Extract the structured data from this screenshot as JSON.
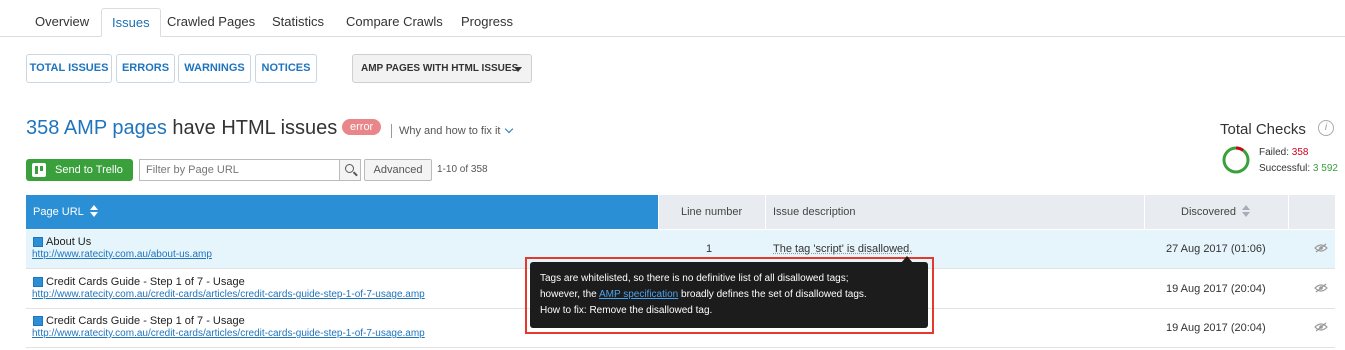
{
  "tabs": [
    "Overview",
    "Issues",
    "Crawled Pages",
    "Statistics",
    "Compare Crawls",
    "Progress"
  ],
  "active_tab": "Issues",
  "filters": [
    "TOTAL ISSUES",
    "ERRORS",
    "WARNINGS",
    "NOTICES"
  ],
  "issue_select": "AMP PAGES WITH HTML ISSUES",
  "heading": {
    "count": "358 AMP pages",
    "rest": " have HTML issues",
    "badge": "error",
    "why": "Why and how to fix it"
  },
  "toolbar": {
    "trello": "Send to Trello",
    "filter_placeholder": "Filter by Page URL",
    "advanced": "Advanced",
    "range": "1-10 of 358"
  },
  "total_checks": {
    "title": "Total Checks",
    "info": "i",
    "failed_label": "Failed:",
    "failed": "358",
    "success_label": "Successful:",
    "success": "3 592",
    "failed_color": "#d0021b",
    "success_color": "#3aa03c"
  },
  "columns": {
    "url": "Page URL",
    "line": "Line number",
    "desc": "Issue description",
    "discovered": "Discovered"
  },
  "rows": [
    {
      "title": "About Us",
      "url": "http://www.ratecity.com.au/about-us.amp",
      "line": "1",
      "desc": "The tag 'script' is disallowed.",
      "date": "27 Aug 2017 (01:06)"
    },
    {
      "title": "Credit Cards Guide - Step 1 of 7 - Usage",
      "url": "http://www.ratecity.com.au/credit-cards/articles/credit-cards-guide-step-1-of-7-usage.amp",
      "line": "",
      "desc": "",
      "date": "19 Aug 2017 (20:04)"
    },
    {
      "title": "Credit Cards Guide - Step 1 of 7 - Usage",
      "url": "http://www.ratecity.com.au/credit-cards/articles/credit-cards-guide-step-1-of-7-usage.amp",
      "line": "",
      "desc": "",
      "date": "19 Aug 2017 (20:04)"
    }
  ],
  "tooltip": {
    "line1": "Tags are whitelisted, so there is no definitive list of all disallowed tags;",
    "line2_pre": "however, the ",
    "link": "AMP specification",
    "line2_post": " broadly defines the set of disallowed tags.",
    "line3": "How to fix: Remove the disallowed tag."
  },
  "colors": {
    "accent": "#1f74bd",
    "header_blue": "#2b8fd6",
    "trello_green": "#3aa03c",
    "badge_red": "#e8868a",
    "highlight_border": "#e4392b"
  }
}
